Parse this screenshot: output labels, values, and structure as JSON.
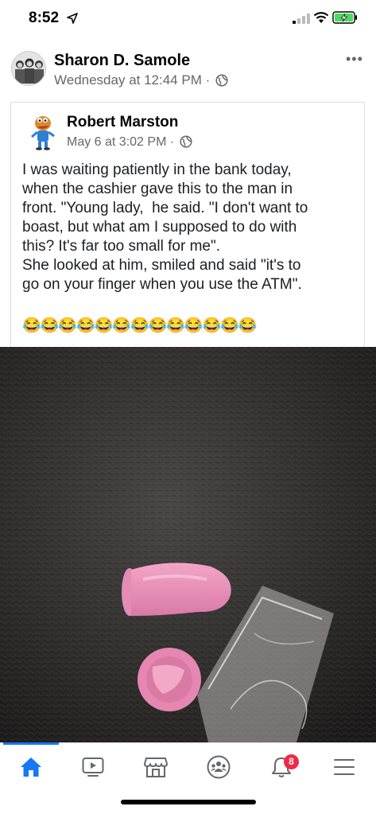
{
  "status_bar": {
    "time": "8:52"
  },
  "post": {
    "author": "Sharon D. Samole",
    "timestamp": "Wednesday at 12:44 PM",
    "privacy_icon": "globe-icon",
    "more_icon": "•••"
  },
  "shared_post": {
    "author": "Robert Marston",
    "timestamp": "May 6 at 3:02 PM",
    "text": "I was waiting patiently in the bank today,\nwhen the cashier gave this to the man in\nfront. \"Young lady,  he said. \"I don't want to\nboast, but what am I supposed to do with\nthis? It's far too small for me\".\nShe looked at him, smiled and said \"it's to\ngo on your finger when you use the ATM\".",
    "emojis": "😂😂😂😂😂😂😂😂😂😂😂😂😂"
  },
  "tab_bar": {
    "tabs": [
      "home-icon",
      "watch-icon",
      "marketplace-icon",
      "groups-icon",
      "notifications-icon",
      "menu-icon"
    ],
    "notification_count": "8",
    "active_color": "#1877f2",
    "badge_color": "#f02849"
  }
}
